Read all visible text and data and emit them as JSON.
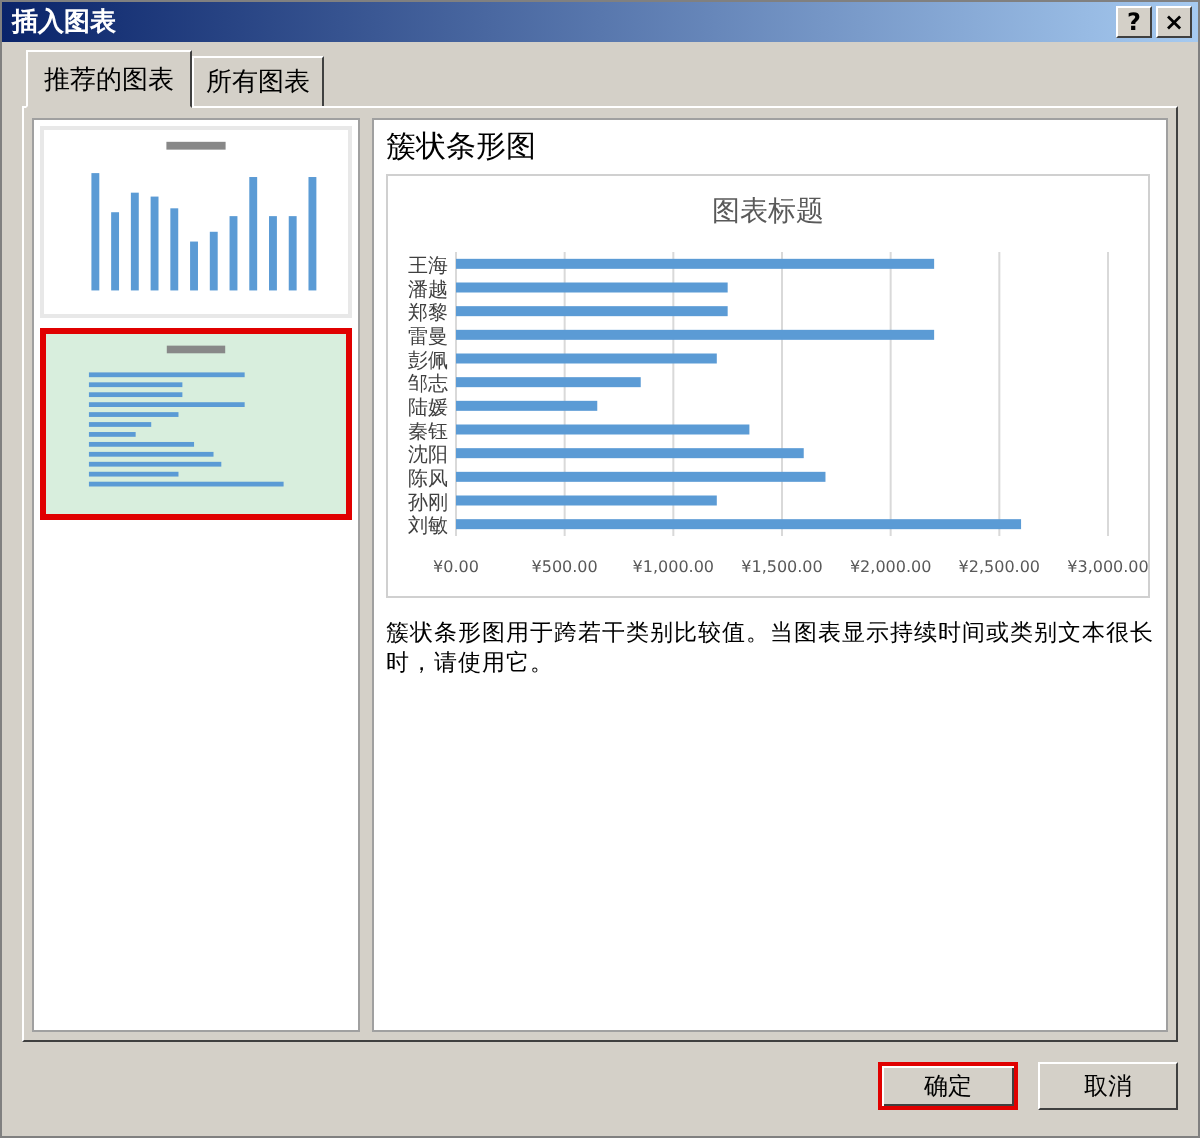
{
  "window": {
    "title": "插入图表",
    "buttons": [
      "?",
      "×"
    ]
  },
  "tabs": [
    {
      "label": "推荐的图表",
      "selected": true
    },
    {
      "label": "所有图表",
      "selected": false
    }
  ],
  "thumbnails": [
    {
      "kind": "column",
      "selected": false
    },
    {
      "kind": "bar",
      "selected": true
    }
  ],
  "preview": {
    "heading": "簇状条形图",
    "chart_data": {
      "type": "bar",
      "orientation": "horizontal",
      "title": "图表标题",
      "categories": [
        "王海",
        "潘越",
        "郑黎",
        "雷曼",
        "彭佩",
        "邹志",
        "陆媛",
        "秦钰",
        "沈阳",
        "陈风",
        "孙刚",
        "刘敏"
      ],
      "values": [
        2200,
        1250,
        1250,
        2200,
        1200,
        850,
        650,
        1350,
        1600,
        1700,
        1200,
        2600
      ],
      "grid": true,
      "xlim": [
        0,
        3000
      ],
      "xticks": [
        {
          "value": 0,
          "label": "¥0.00"
        },
        {
          "value": 500,
          "label": "¥500.00"
        },
        {
          "value": 1000,
          "label": "¥1,000.00"
        },
        {
          "value": 1500,
          "label": "¥1,500.00"
        },
        {
          "value": 2000,
          "label": "¥2,000.00"
        },
        {
          "value": 2500,
          "label": "¥2,500.00"
        },
        {
          "value": 3000,
          "label": "¥3,000.00"
        }
      ]
    },
    "description": "簇状条形图用于跨若干类别比较值。当图表显示持续时间或类别文本很长时，请使用它。"
  },
  "footer_buttons": [
    {
      "label": "确定",
      "highlighted": true
    },
    {
      "label": "取消",
      "highlighted": false
    }
  ]
}
